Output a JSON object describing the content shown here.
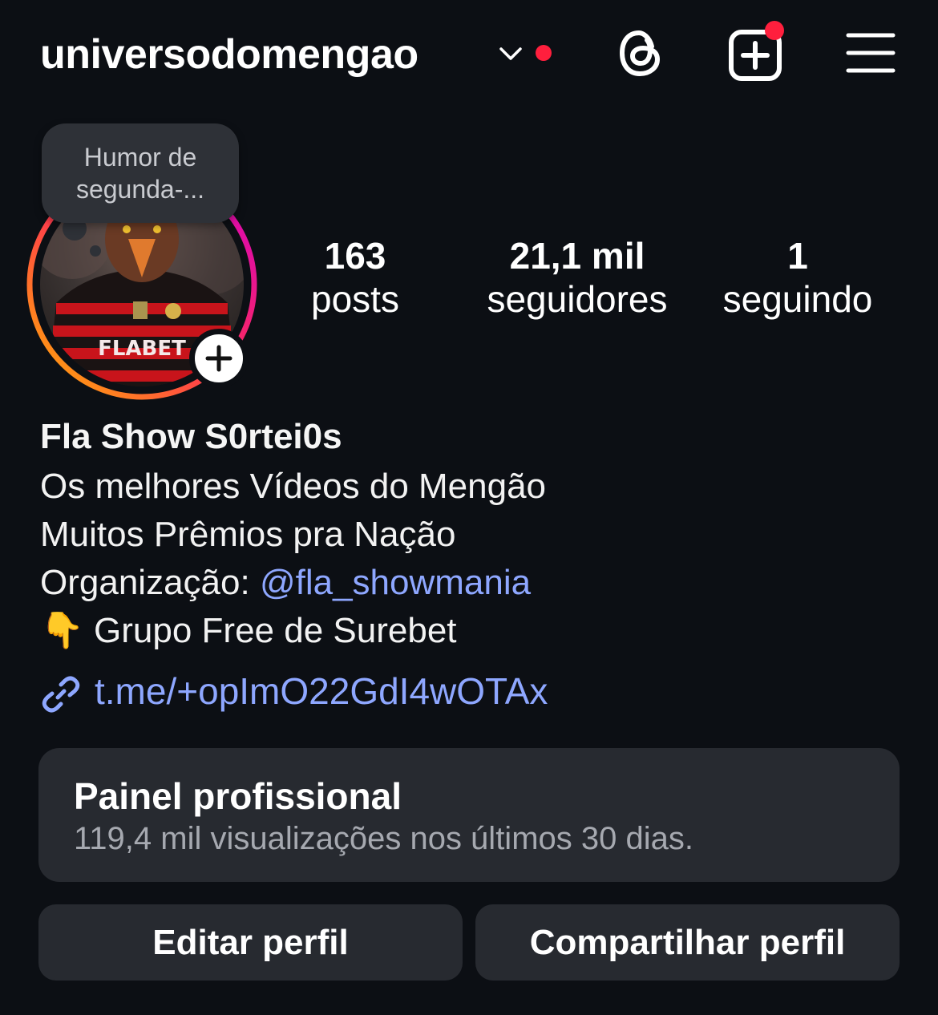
{
  "header": {
    "username": "universodomengao",
    "colors": {
      "notification_dot": "#ff1f3d"
    },
    "icons": [
      "chevron-down-icon",
      "threads-icon",
      "new-post-icon",
      "menu-icon"
    ]
  },
  "profile": {
    "note": "Humor de segunda-...",
    "avatar_shirt_text": "FLABET",
    "ring_colors": [
      "#ff9a00",
      "#ff2d55",
      "#d300c5"
    ]
  },
  "stats": [
    {
      "value": "163",
      "label": "posts"
    },
    {
      "value": "21,1 mil",
      "label": "seguidores"
    },
    {
      "value": "1",
      "label": "seguindo"
    }
  ],
  "bio": {
    "name": "Fla Show S0rtei0s",
    "line1": "Os melhores Vídeos do Mengão",
    "line2": "Muitos Prêmios pra Nação",
    "line3_prefix": "Organização: ",
    "line3_mention": "@fla_showmania",
    "line4_emoji": "👇",
    "line4_text": "Grupo Free de Surebet",
    "link": "t.me/+opImO22GdI4wOTAx",
    "link_color": "#8ea7ff"
  },
  "panel": {
    "title": "Painel profissional",
    "subtitle": "119,4 mil visualizações nos últimos 30 dias."
  },
  "buttons": {
    "edit": "Editar perfil",
    "share": "Compartilhar perfil"
  }
}
